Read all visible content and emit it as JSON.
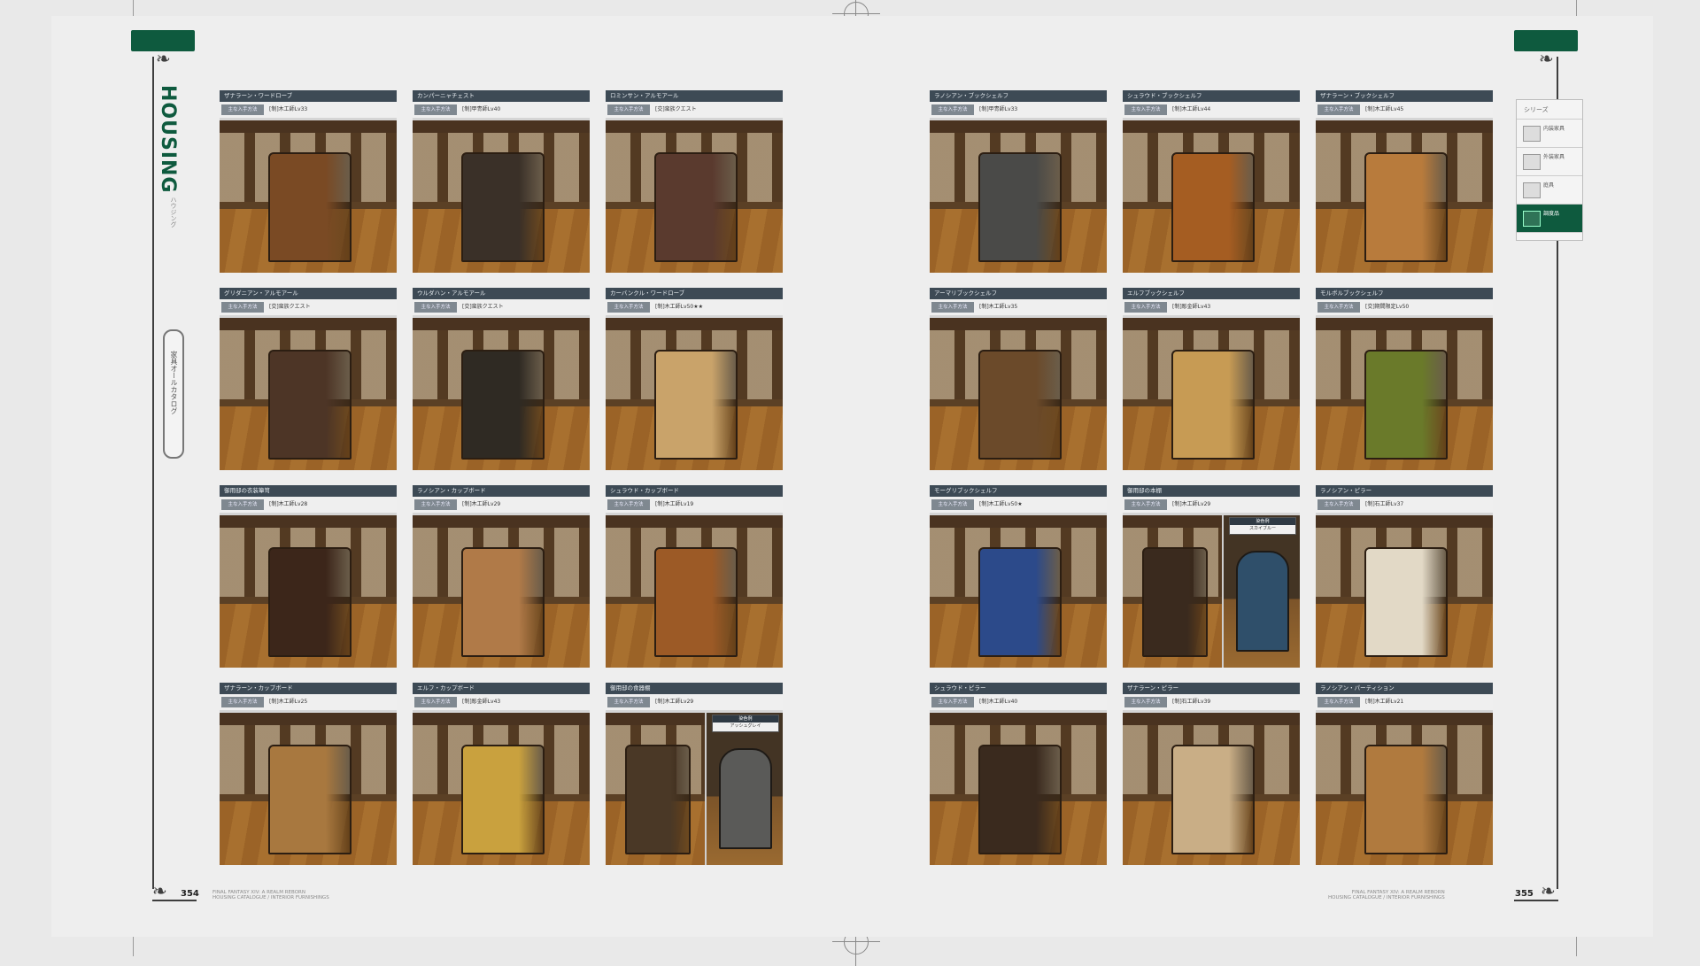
{
  "left_page": {
    "section_title": "HOUSING",
    "section_subtitle": "ハウジング",
    "side_tab_label": "家具オールカタログ",
    "page_number": "354",
    "footer_line1": "FINAL FANTASY XIV: A REALM REBORN",
    "footer_line2": "HOUSING CATALOGUE / INTERIOR FURNISHINGS"
  },
  "right_page": {
    "page_number": "355",
    "footer_line1": "FINAL FANTASY XIV: A REALM REBORN",
    "footer_line2": "HOUSING CATALOGUE / INTERIOR FURNISHINGS",
    "index_header": "シリーズ",
    "index_items": [
      {
        "label": "内装家具",
        "active": false
      },
      {
        "label": "外装家具",
        "active": false
      },
      {
        "label": "庭具",
        "active": false
      },
      {
        "label": "調度品",
        "active": true
      }
    ]
  },
  "items_left": [
    {
      "name": "ザナラーン・ワードローブ",
      "tag": "主な入手方法",
      "info": "[制]木工師Lv33",
      "body": "#7a4a24"
    },
    {
      "name": "カンパーニャチェスト",
      "tag": "主な入手方法",
      "info": "[制]甲冑師Lv40",
      "body": "#3a3028"
    },
    {
      "name": "ロミンサン・アルモアール",
      "tag": "主な入手方法",
      "info": "[交]蛮族クエスト",
      "body": "#5a3a2e"
    },
    {
      "name": "グリダニアン・アルモアール",
      "tag": "主な入手方法",
      "info": "[交]蛮族クエスト",
      "body": "#4d3526"
    },
    {
      "name": "ウルダハン・アルモアール",
      "tag": "主な入手方法",
      "info": "[交]蛮族クエスト",
      "body": "#2f2a23"
    },
    {
      "name": "カーバンクル・ワードローブ",
      "tag": "主な入手方法",
      "info": "[制]木工師Lv50★★",
      "body": "#c9a36a"
    },
    {
      "name": "御用邸の衣装簞笥",
      "tag": "主な入手方法",
      "info": "[制]木工師Lv28",
      "body": "#3c261a"
    },
    {
      "name": "ラノシアン・カップボード",
      "tag": "主な入手方法",
      "info": "[制]木工師Lv29",
      "body": "#b07a48"
    },
    {
      "name": "シュラウド・カップボード",
      "tag": "主な入手方法",
      "info": "[制]木工師Lv19",
      "body": "#9c5a26"
    },
    {
      "name": "ザナラーン・カップボード",
      "tag": "主な入手方法",
      "info": "[制]木工師Lv25",
      "body": "#a8783f"
    },
    {
      "name": "エルフ・カップボード",
      "tag": "主な入手方法",
      "info": "[制]彫金師Lv43",
      "body": "#c9a13e"
    },
    {
      "name": "御用邸の食器棚",
      "tag": "主な入手方法",
      "info": "[制]木工師Lv29",
      "body": "#4a3826",
      "inset_header": "染色例",
      "inset_label": "アッシュグレイ",
      "inset_body": "#5a5a58"
    }
  ],
  "items_right": [
    {
      "name": "ラノシアン・ブックシェルフ",
      "tag": "主な入手方法",
      "info": "[制]甲冑師Lv33",
      "body": "#4a4a48"
    },
    {
      "name": "シュラウド・ブックシェルフ",
      "tag": "主な入手方法",
      "info": "[制]木工師Lv44",
      "body": "#a55d22"
    },
    {
      "name": "ザナラーン・ブックシェルフ",
      "tag": "主な入手方法",
      "info": "[制]木工師Lv45",
      "body": "#b87b3c"
    },
    {
      "name": "アーマリブックシェルフ",
      "tag": "主な入手方法",
      "info": "[制]木工師Lv35",
      "body": "#6b4a2a"
    },
    {
      "name": "エルフブックシェルフ",
      "tag": "主な入手方法",
      "info": "[制]彫金師Lv43",
      "body": "#c79b54"
    },
    {
      "name": "モルボルブックシェルフ",
      "tag": "主な入手方法",
      "info": "[交]期間限定Lv50",
      "body": "#6a7a2a"
    },
    {
      "name": "モーグリブックシェルフ",
      "tag": "主な入手方法",
      "info": "[制]木工師Lv50★",
      "body": "#2c4a8a"
    },
    {
      "name": "御用邸の本棚",
      "tag": "主な入手方法",
      "info": "[制]木工師Lv29",
      "body": "#3a2a1e",
      "inset_header": "染色例",
      "inset_label": "スカイブルー",
      "inset_body": "#2f4f6a"
    },
    {
      "name": "ラノシアン・ピラー",
      "tag": "主な入手方法",
      "info": "[制]石工師Lv37",
      "body": "#e2d9c6"
    },
    {
      "name": "シュラウド・ピラー",
      "tag": "主な入手方法",
      "info": "[制]木工師Lv40",
      "body": "#3a2a1e"
    },
    {
      "name": "ザナラーン・ピラー",
      "tag": "主な入手方法",
      "info": "[制]石工師Lv39",
      "body": "#c9ae86"
    },
    {
      "name": "ラノシアン・パーティション",
      "tag": "主な入手方法",
      "info": "[制]木工師Lv21",
      "body": "#b07a3e"
    }
  ]
}
